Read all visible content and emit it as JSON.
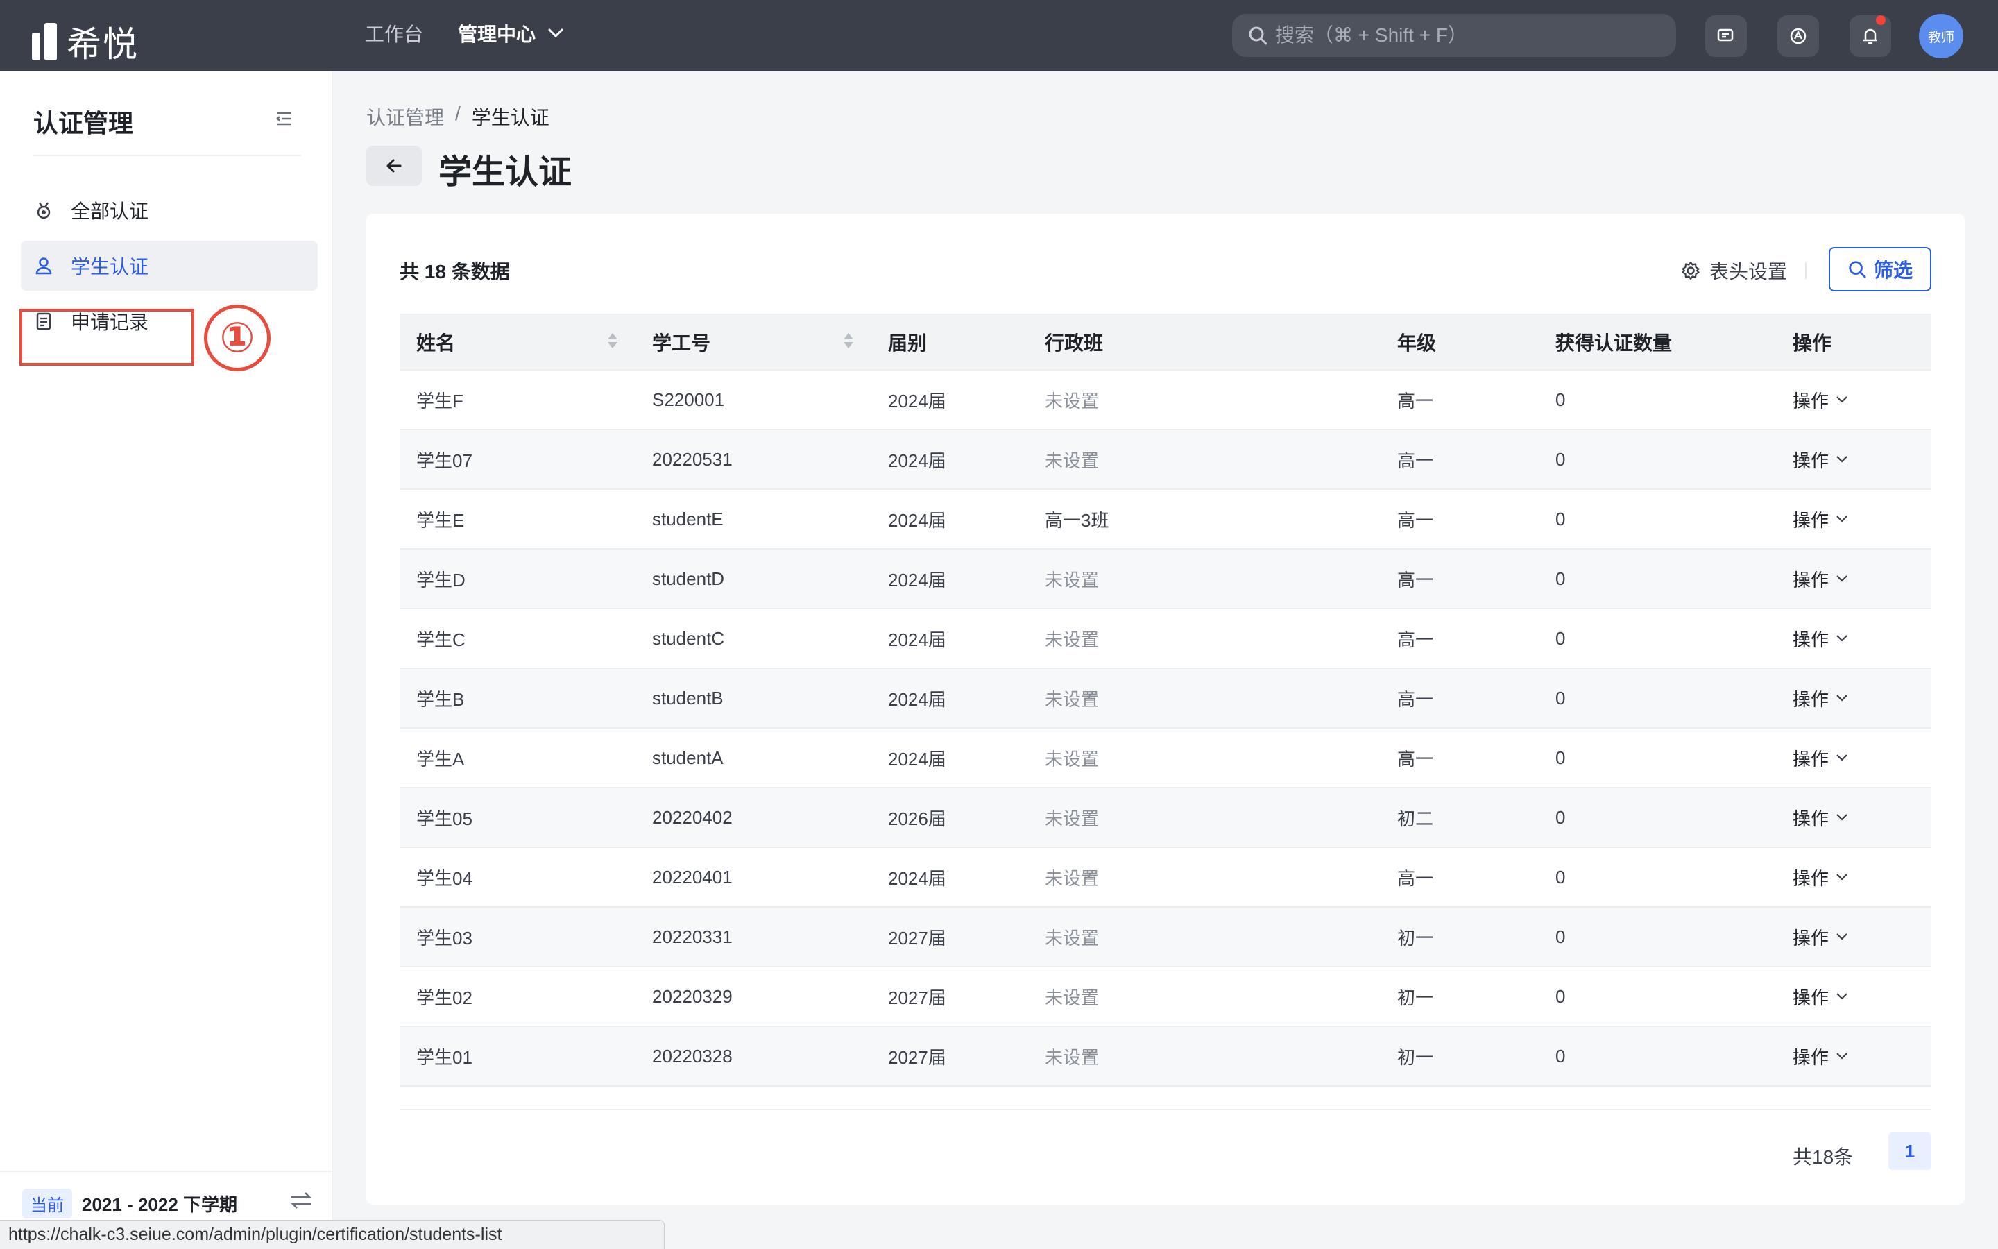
{
  "app": {
    "name": "希悦"
  },
  "topnav": {
    "workbench": "工作台",
    "admin_center": "管理中心"
  },
  "search": {
    "placeholder": "搜索（⌘ + Shift + F）"
  },
  "user": {
    "avatar_text": "教师"
  },
  "colors": {
    "accent": "#2b5ce6",
    "topbar": "#3b3f4a",
    "annotation": "#e74c3c"
  },
  "sidebar": {
    "title": "认证管理",
    "items": [
      {
        "label": "全部认证",
        "icon": "medal-icon"
      },
      {
        "label": "学生认证",
        "icon": "user-icon",
        "active": true
      },
      {
        "label": "申请记录",
        "icon": "document-icon"
      }
    ],
    "annotation": "①",
    "term_tag": "当前",
    "term": "2021 - 2022 下学期"
  },
  "status_url": "https://chalk-c3.seiue.com/admin/plugin/certification/students-list",
  "breadcrumb": {
    "parent": "认证管理",
    "sep": "/",
    "current": "学生认证"
  },
  "page": {
    "title": "学生认证"
  },
  "toolbar": {
    "total": "共 18 条数据",
    "column_settings": "表头设置",
    "filter": "筛选"
  },
  "table": {
    "columns": [
      "姓名",
      "学工号",
      "届别",
      "行政班",
      "年级",
      "获得认证数量",
      "操作"
    ],
    "rows": [
      [
        "学生F",
        "S220001",
        "2024届",
        "未设置",
        "高一",
        "0",
        "操作"
      ],
      [
        "学生07",
        "20220531",
        "2024届",
        "未设置",
        "高一",
        "0",
        "操作"
      ],
      [
        "学生E",
        "studentE",
        "2024届",
        "高一3班",
        "高一",
        "0",
        "操作"
      ],
      [
        "学生D",
        "studentD",
        "2024届",
        "未设置",
        "高一",
        "0",
        "操作"
      ],
      [
        "学生C",
        "studentC",
        "2024届",
        "未设置",
        "高一",
        "0",
        "操作"
      ],
      [
        "学生B",
        "studentB",
        "2024届",
        "未设置",
        "高一",
        "0",
        "操作"
      ],
      [
        "学生A",
        "studentA",
        "2024届",
        "未设置",
        "高一",
        "0",
        "操作"
      ],
      [
        "学生05",
        "20220402",
        "2026届",
        "未设置",
        "初二",
        "0",
        "操作"
      ],
      [
        "学生04",
        "20220401",
        "2024届",
        "未设置",
        "高一",
        "0",
        "操作"
      ],
      [
        "学生03",
        "20220331",
        "2027届",
        "未设置",
        "初一",
        "0",
        "操作"
      ],
      [
        "学生02",
        "20220329",
        "2027届",
        "未设置",
        "初一",
        "0",
        "操作"
      ],
      [
        "学生01",
        "20220328",
        "2027届",
        "未设置",
        "初一",
        "0",
        "操作"
      ]
    ]
  },
  "pagination": {
    "total": "共18条",
    "current": "1"
  }
}
